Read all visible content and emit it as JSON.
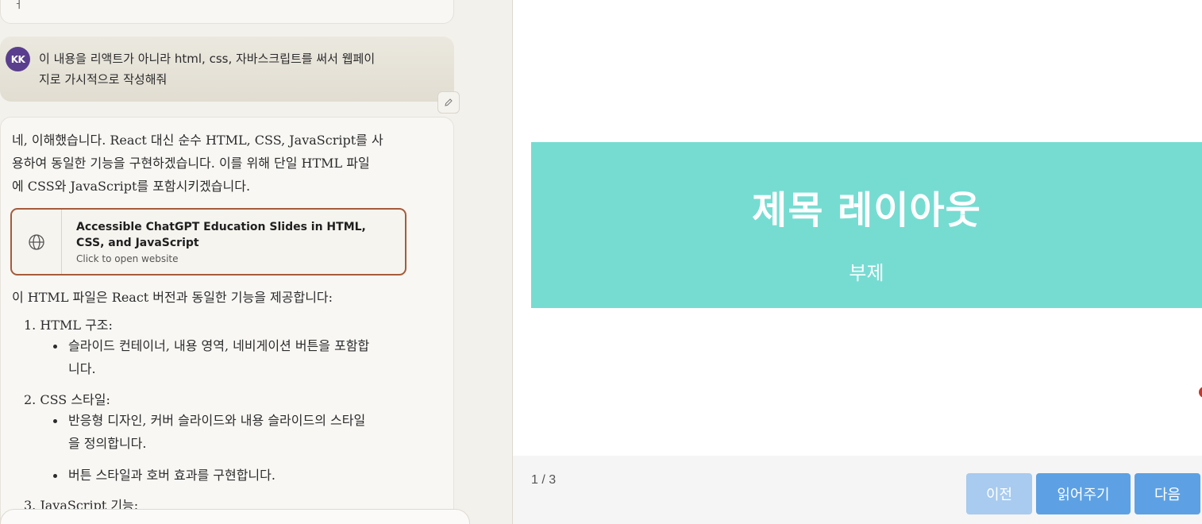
{
  "chat": {
    "previous_fragment": "ㅓ",
    "user": {
      "initials": "KK",
      "line1": "이 내용을 리액트가 아니라 html, css, 자바스크립트를 써서 웹페이",
      "line2": "지로 가시적으로 작성해줘"
    },
    "assistant": {
      "intro_line1": "네, 이해했습니다. React 대신 순수 HTML, CSS, JavaScript를 사",
      "intro_line2": "용하여 동일한 기능을 구현하겠습니다. 이를 위해 단일 HTML 파일",
      "intro_line3": "에 CSS와 JavaScript를 포함시키겠습니다.",
      "artifact": {
        "icon": "globe-icon",
        "title": "Accessible ChatGPT Education Slides in HTML, CSS, and JavaScript",
        "subtitle": "Click to open website"
      },
      "summary": "이 HTML 파일은 React 버전과 동일한 기능을 제공합니다:",
      "list": [
        {
          "label": "1. HTML 구조:",
          "bullets": [
            {
              "line1": "슬라이드 컨테이너, 내용 영역, 네비게이션 버튼을 포함합",
              "line2": "니다."
            }
          ]
        },
        {
          "label": "2. CSS 스타일:",
          "bullets": [
            {
              "line1": "반응형 디자인, 커버 슬라이드와 내용 슬라이드의 스타일",
              "line2": "을 정의합니다."
            },
            {
              "line1": "버튼 스타일과 호버 효과를 구현합니다.",
              "line2": ""
            }
          ]
        },
        {
          "label": "3. JavaScript 기능:",
          "bullets": []
        }
      ]
    }
  },
  "preview": {
    "slide": {
      "title": "제목 레이아웃",
      "subtitle": "부제",
      "background": "#76dcd2"
    },
    "page_indicator": "1 / 3",
    "buttons": {
      "prev": "이전",
      "read": "읽어주기",
      "next": "다음"
    }
  }
}
